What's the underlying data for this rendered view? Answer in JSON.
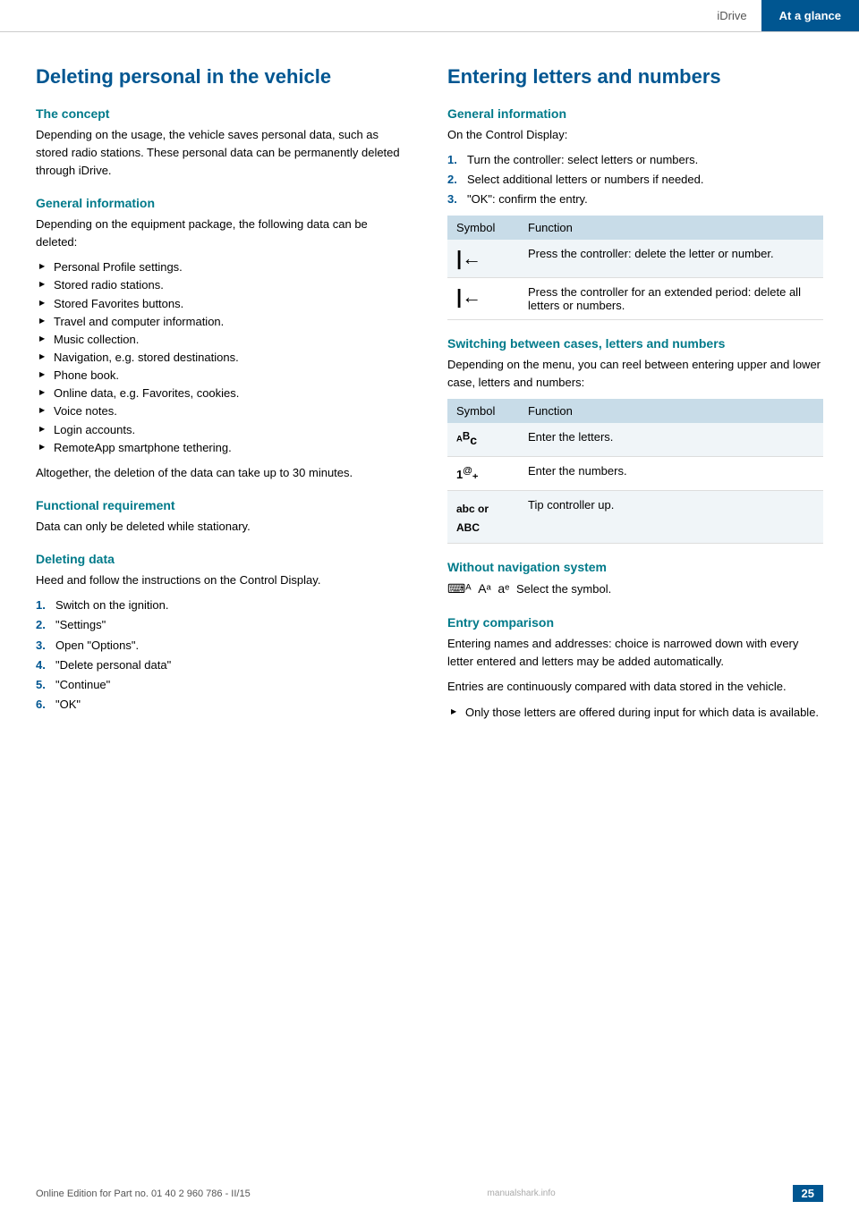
{
  "header": {
    "idrive_label": "iDrive",
    "ataglance_label": "At a glance"
  },
  "left": {
    "main_title": "Deleting personal in the vehicle",
    "concept": {
      "heading": "The concept",
      "body": "Depending on the usage, the vehicle saves personal data, such as stored radio stations. These personal data can be permanently deleted through iDrive."
    },
    "general_info": {
      "heading": "General information",
      "intro": "Depending on the equipment package, the following data can be deleted:",
      "items": [
        "Personal Profile settings.",
        "Stored radio stations.",
        "Stored Favorites buttons.",
        "Travel and computer information.",
        "Music collection.",
        "Navigation, e.g. stored destinations.",
        "Phone book.",
        "Online data, e.g. Favorites, cookies.",
        "Voice notes.",
        "Login accounts.",
        "RemoteApp smartphone tethering."
      ],
      "footer_text": "Altogether, the deletion of the data can take up to 30 minutes."
    },
    "functional_req": {
      "heading": "Functional requirement",
      "body": "Data can only be deleted while stationary."
    },
    "deleting_data": {
      "heading": "Deleting data",
      "intro": "Heed and follow the instructions on the Control Display.",
      "steps": [
        "Switch on the ignition.",
        "\"Settings\"",
        "Open \"Options\".",
        "\"Delete personal data\"",
        "\"Continue\"",
        "\"OK\""
      ]
    }
  },
  "right": {
    "main_title": "Entering letters and numbers",
    "general_info": {
      "heading": "General information",
      "intro": "On the Control Display:",
      "steps": [
        "Turn the controller: select letters or numbers.",
        "Select additional letters or numbers if needed.",
        "\"OK\": confirm the entry."
      ]
    },
    "table1": {
      "col1": "Symbol",
      "col2": "Function",
      "rows": [
        {
          "symbol": "⏮",
          "function": "Press the controller: delete the letter or number."
        },
        {
          "symbol": "⏮",
          "function": "Press the controller for an extended period: delete all letters or numbers."
        }
      ]
    },
    "switching": {
      "heading": "Switching between cases, letters and numbers",
      "body": "Depending on the menu, you can reel between entering upper and lower case, letters and numbers:",
      "col1": "Symbol",
      "col2": "Function",
      "rows": [
        {
          "symbol": "ᴬBc",
          "function": "Enter the letters."
        },
        {
          "symbol": "1@₊",
          "function": "Enter the numbers."
        },
        {
          "symbol": "abc or ABC",
          "function": "Tip controller up."
        }
      ]
    },
    "without_nav": {
      "heading": "Without navigation system",
      "symbols": "⌨ᴬ  Aᵃ  aᵉ",
      "body": "Select the symbol."
    },
    "entry_comparison": {
      "heading": "Entry comparison",
      "body1": "Entering names and addresses: choice is narrowed down with every letter entered and letters may be added automatically.",
      "body2": "Entries are continuously compared with data stored in the vehicle.",
      "bullet": "Only those letters are offered during input for which data is available."
    }
  },
  "footer": {
    "text": "Online Edition for Part no. 01 40 2 960 786 - II/15",
    "page": "25",
    "site": "manualshark.info"
  }
}
